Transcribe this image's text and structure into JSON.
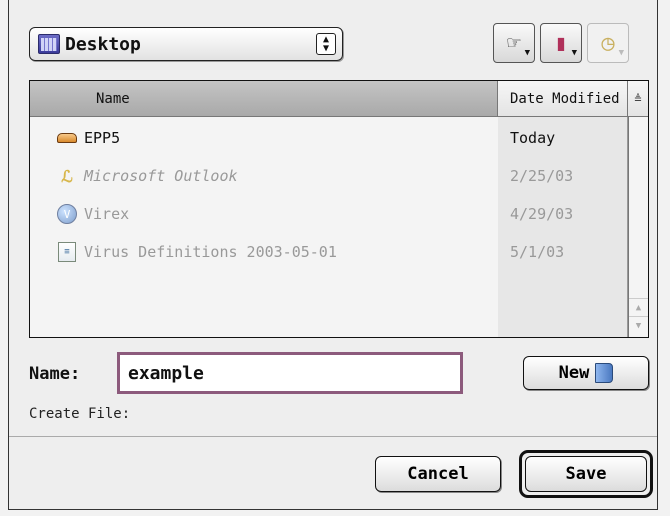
{
  "location_popup": {
    "label": "Desktop",
    "icon": "desktop-icon"
  },
  "toolbar": {
    "shortcuts_icon": "pointing-hand-icon",
    "favorites_icon": "favorites-book-icon",
    "recent_icon": "clock-icon"
  },
  "file_list": {
    "columns": {
      "name": "Name",
      "date": "Date Modified",
      "sort_indicator": "≜"
    },
    "rows": [
      {
        "name": "EPP5",
        "date": "Today",
        "icon": "disk-icon",
        "dimmed": false,
        "italic": false
      },
      {
        "name": "Microsoft Outlook",
        "date": "2/25/03",
        "icon": "outlook-alias-icon",
        "dimmed": true,
        "italic": true
      },
      {
        "name": "Virex",
        "date": "4/29/03",
        "icon": "virex-icon",
        "dimmed": true,
        "italic": false
      },
      {
        "name": "Virus Definitions 2003-05-01",
        "date": "5/1/03",
        "icon": "document-icon",
        "dimmed": true,
        "italic": false
      }
    ]
  },
  "name_field": {
    "label": "Name:",
    "value": "example"
  },
  "new_button": {
    "label": "New"
  },
  "create_label": "Create File:",
  "buttons": {
    "cancel": "Cancel",
    "save": "Save"
  },
  "colors": {
    "focus_ring": "#8c5a7c",
    "header_selected": "#b5b5b5"
  }
}
